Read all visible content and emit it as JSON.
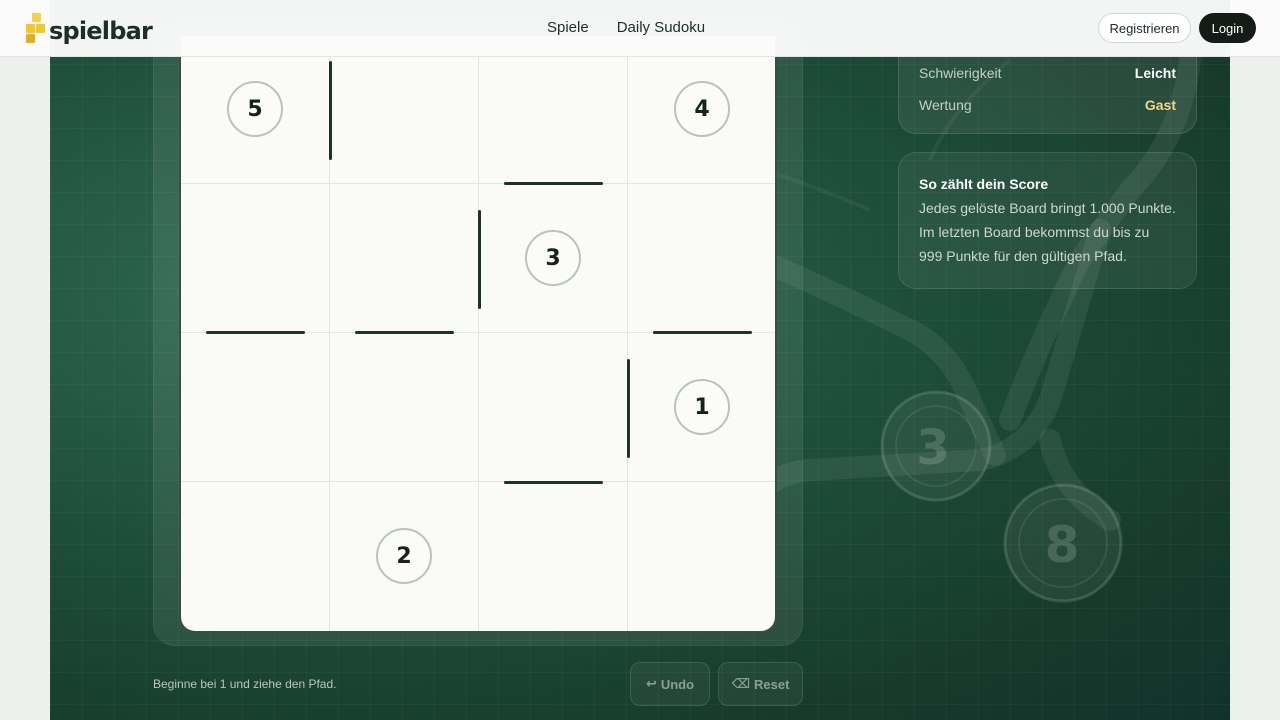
{
  "header": {
    "logo_text": "spielbar",
    "nav": [
      "Spiele",
      "Daily Sudoku"
    ],
    "register_label": "Registrieren",
    "login_label": "Login"
  },
  "board": {
    "numbers": [
      "5",
      "4",
      "3",
      "1",
      "2"
    ]
  },
  "info": {
    "difficulty_label": "Schwierigkeit",
    "difficulty_value": "Leicht",
    "rating_label": "Wertung",
    "rating_value": "Gast"
  },
  "score_card": {
    "title": "So zählt dein Score",
    "text": "Jedes gelöste Board bringt 1.000 Punkte. Im letzten Board bekommst du bis zu 999 Punkte für den gültigen Pfad."
  },
  "footer": {
    "hint": "Beginne bei 1 und ziehe den Pfad.",
    "undo_icon": "↩",
    "undo_label": "Undo",
    "reset_icon": "⌫",
    "reset_label": "Reset"
  },
  "background_numbers": [
    "3",
    "8"
  ],
  "colors": {
    "accent_gold": "#f3d77e",
    "board_bg": "#fafbf6",
    "stage_green": "#1e4e3b",
    "wall": "#1c3329"
  }
}
